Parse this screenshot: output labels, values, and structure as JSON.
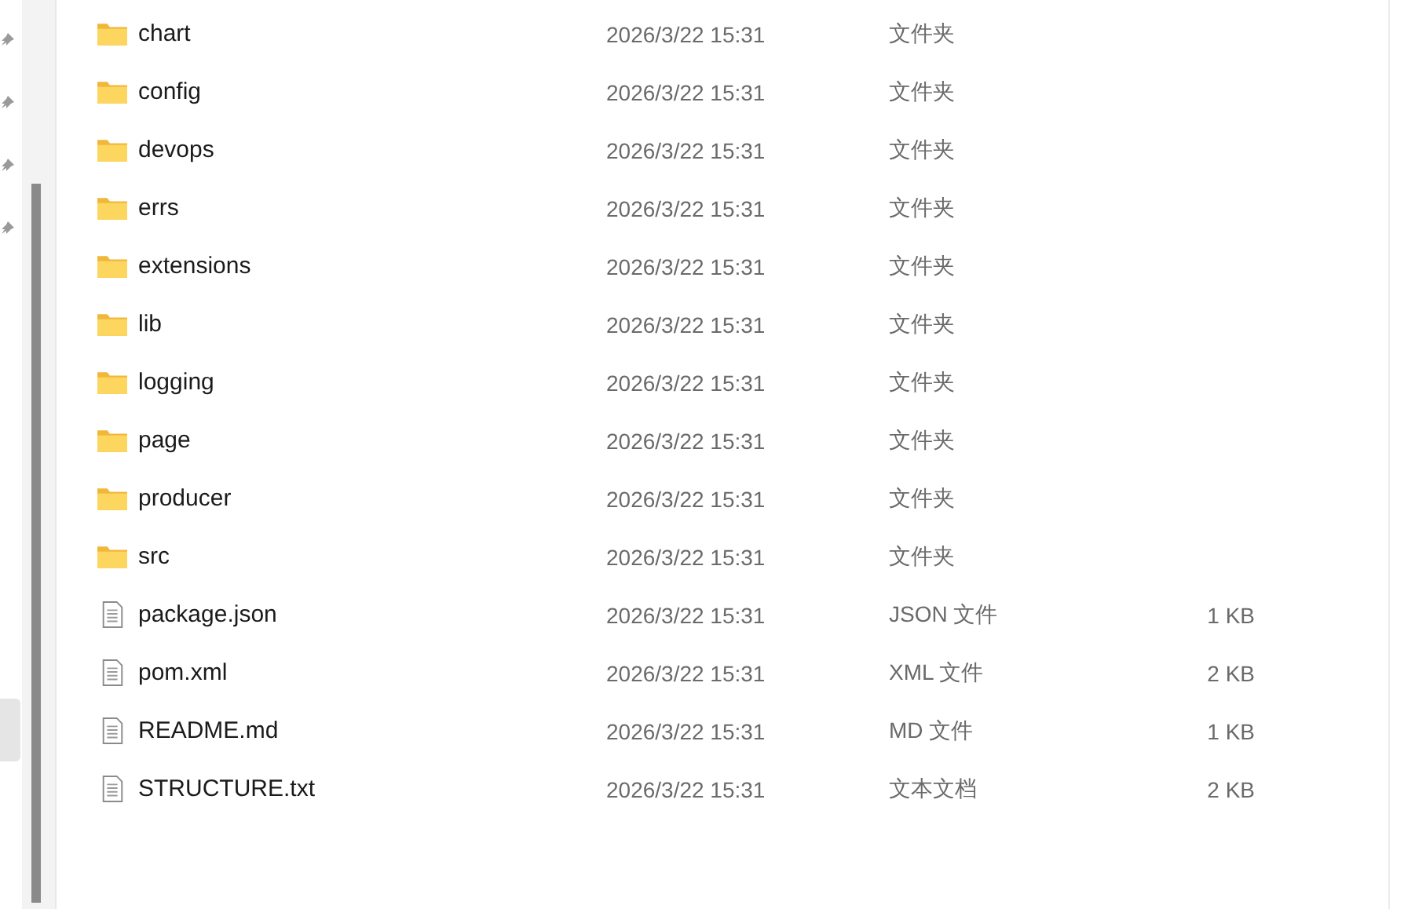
{
  "files": [
    {
      "kind": "folder",
      "name": "chart",
      "date": "2026/3/22 15:31",
      "type": "文件夹"
    },
    {
      "kind": "folder",
      "name": "config",
      "date": "2026/3/22 15:31",
      "type": "文件夹"
    },
    {
      "kind": "folder",
      "name": "devops",
      "date": "2026/3/22 15:31",
      "type": "文件夹"
    },
    {
      "kind": "folder",
      "name": "errs",
      "date": "2026/3/22 15:31",
      "type": "文件夹"
    },
    {
      "kind": "folder",
      "name": "extensions",
      "date": "2026/3/22 15:31",
      "type": "文件夹"
    },
    {
      "kind": "folder",
      "name": "lib",
      "date": "2026/3/22 15:31",
      "type": "文件夹"
    },
    {
      "kind": "folder",
      "name": "logging",
      "date": "2026/3/22 15:31",
      "type": "文件夹"
    },
    {
      "kind": "folder",
      "name": "page",
      "date": "2026/3/22 15:31",
      "type": "文件夹"
    },
    {
      "kind": "folder",
      "name": "producer",
      "date": "2026/3/22 15:31",
      "type": "文件夹"
    },
    {
      "kind": "folder",
      "name": "src",
      "date": "2026/3/22 15:31",
      "type": "文件夹"
    },
    {
      "kind": "file",
      "name": "package.json",
      "date": "2026/3/22 15:31",
      "type": "JSON 文件",
      "size": "1 KB"
    },
    {
      "kind": "file",
      "name": "pom.xml",
      "date": "2026/3/22 15:31",
      "type": "XML 文件",
      "size": "2 KB"
    },
    {
      "kind": "file",
      "name": "README.md",
      "date": "2026/3/22 15:31",
      "type": "MD 文件",
      "size": "1 KB"
    },
    {
      "kind": "file",
      "name": "STRUCTURE.txt",
      "date": "2026/3/22 15:31",
      "type": "文本文档",
      "size": "2 KB"
    }
  ]
}
